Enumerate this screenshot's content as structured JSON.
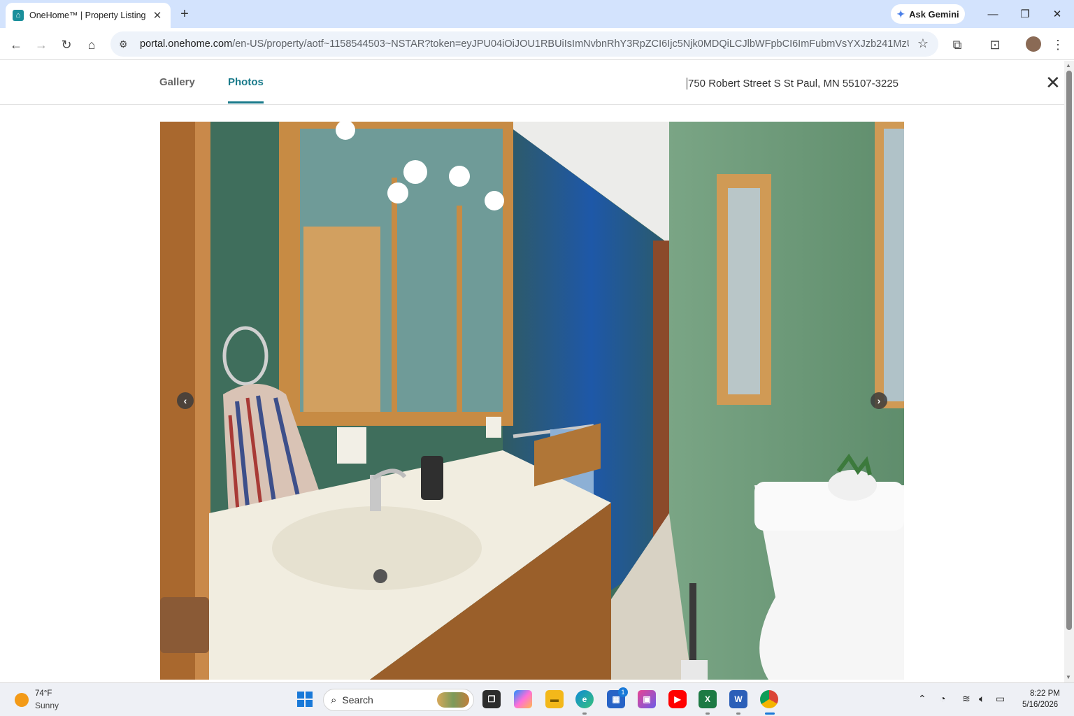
{
  "browser": {
    "tab_title": "OneHome™ | Property Listing",
    "ask_gemini_label": "Ask Gemini",
    "url_host": "portal.onehome.com",
    "url_path": "/en-US/property/aotf~1158544503~NSTAR?token=eyJPU04iOiJOU1RBUiIsImNvbnRhY3RpZCI6Ijc5Njk0MDQiLCJlbWFpbCI6ImFubmVsYXJzb241MzUzQGdtY..."
  },
  "viewer": {
    "tabs": [
      {
        "label": "Gallery",
        "active": false
      },
      {
        "label": "Photos",
        "active": true
      }
    ],
    "address": "750 Robert Street S St Paul, MN 55107-3225",
    "accent_color": "#197a8a",
    "photo_description_icon": "bathroom-photo"
  },
  "taskbar": {
    "weather_temp": "74°F",
    "weather_condition": "Sunny",
    "search_label": "Search",
    "store_badge": "1",
    "clock_time": "8:22 PM",
    "clock_date": "5/16/2026"
  }
}
